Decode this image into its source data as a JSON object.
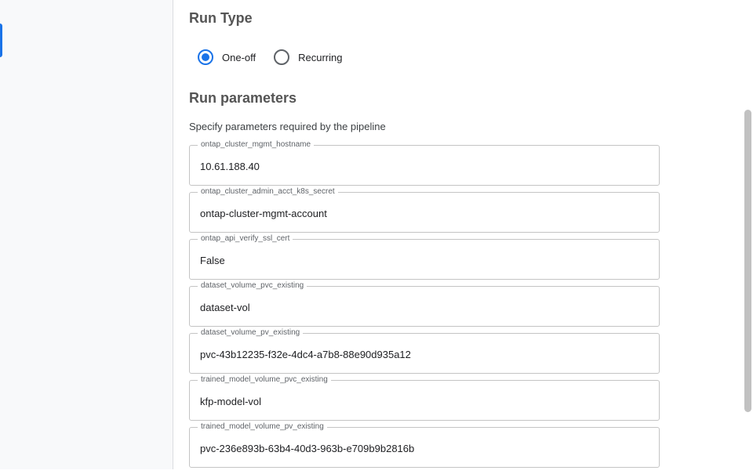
{
  "run_type": {
    "title": "Run Type",
    "options": [
      {
        "label": "One-off",
        "selected": true
      },
      {
        "label": "Recurring",
        "selected": false
      }
    ]
  },
  "run_parameters": {
    "title": "Run parameters",
    "subtitle": "Specify parameters required by the pipeline",
    "fields": [
      {
        "label": "ontap_cluster_mgmt_hostname",
        "value": "10.61.188.40"
      },
      {
        "label": "ontap_cluster_admin_acct_k8s_secret",
        "value": "ontap-cluster-mgmt-account"
      },
      {
        "label": "ontap_api_verify_ssl_cert",
        "value": "False"
      },
      {
        "label": "dataset_volume_pvc_existing",
        "value": "dataset-vol"
      },
      {
        "label": "dataset_volume_pv_existing",
        "value": "pvc-43b12235-f32e-4dc4-a7b8-88e90d935a12"
      },
      {
        "label": "trained_model_volume_pvc_existing",
        "value": "kfp-model-vol"
      },
      {
        "label": "trained_model_volume_pv_existing",
        "value": "pvc-236e893b-63b4-40d3-963b-e709b9b2816b"
      }
    ]
  },
  "colors": {
    "accent": "#1a73e8",
    "sidebar_bg": "#f8f9fa",
    "border": "#c4c4c4"
  }
}
